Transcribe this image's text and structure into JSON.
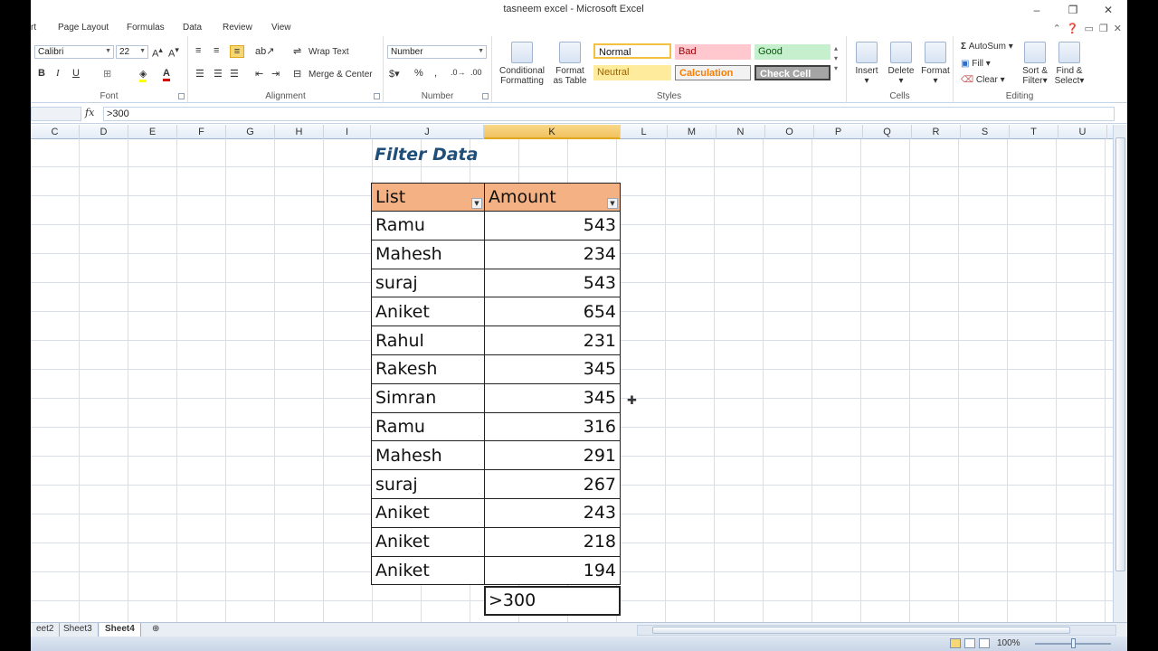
{
  "window": {
    "title": "tasneem excel  -  Microsoft Excel",
    "controls": [
      "minimize",
      "restore",
      "close"
    ]
  },
  "ribbon_tabs": [
    "rt",
    "Page Layout",
    "Formulas",
    "Data",
    "Review",
    "View"
  ],
  "ribbon": {
    "font": {
      "name": "Calibri",
      "size": "22",
      "label": "Font"
    },
    "alignment": {
      "wrap_text": "Wrap Text",
      "merge_center": "Merge & Center",
      "label": "Alignment"
    },
    "number": {
      "format": "Number",
      "label": "Number"
    },
    "styles": {
      "conditional": "Conditional Formatting",
      "conditional_l1": "Conditional",
      "conditional_l2": "Formatting",
      "format_table_l1": "Format",
      "format_table_l2": "as Table",
      "normal": "Normal",
      "bad": "Bad",
      "good": "Good",
      "neutral": "Neutral",
      "calculation": "Calculation",
      "check_cell": "Check Cell",
      "label": "Styles"
    },
    "cells": {
      "insert": "Insert",
      "delete": "Delete",
      "format": "Format",
      "label": "Cells"
    },
    "editing": {
      "autosum": "AutoSum",
      "fill": "Fill",
      "clear": "Clear",
      "sort_l1": "Sort &",
      "sort_l2": "Filter",
      "find_l1": "Find &",
      "find_l2": "Select",
      "label": "Editing"
    }
  },
  "formula_bar": {
    "fx": "fx",
    "content": ">300"
  },
  "columns": [
    "C",
    "D",
    "E",
    "F",
    "G",
    "H",
    "I",
    "J",
    "K",
    "L",
    "M",
    "N",
    "O",
    "P",
    "Q",
    "R",
    "S",
    "T",
    "U"
  ],
  "selected_column": "K",
  "sheet": {
    "title": "Filter Data",
    "headers": [
      "List",
      "Amount"
    ],
    "rows": [
      [
        "Ramu",
        "543"
      ],
      [
        "Mahesh",
        "234"
      ],
      [
        "suraj",
        "543"
      ],
      [
        "Aniket",
        "654"
      ],
      [
        "Rahul",
        "231"
      ],
      [
        "Rakesh",
        "345"
      ],
      [
        "Simran",
        "345"
      ],
      [
        "Ramu",
        "316"
      ],
      [
        "Mahesh",
        "291"
      ],
      [
        "suraj",
        "267"
      ],
      [
        "Aniket",
        "243"
      ],
      [
        "Aniket",
        "218"
      ],
      [
        "Aniket",
        "194"
      ]
    ],
    "criteria": ">300"
  },
  "sheet_tabs": [
    "eet2",
    "Sheet3",
    "Sheet4"
  ],
  "active_sheet": "Sheet4",
  "status": {
    "zoom": "100%"
  }
}
